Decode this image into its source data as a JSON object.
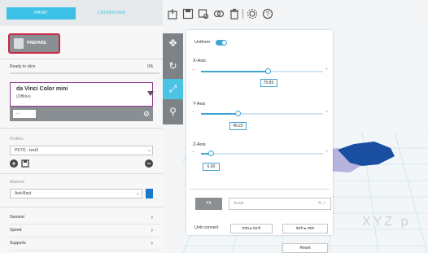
{
  "tabs": {
    "print": "PRINT",
    "catalog": "CATABRONIE"
  },
  "toolbar": {
    "icons": [
      "box-add-icon",
      "save-icon",
      "view-icon",
      "group-icon",
      "trash-icon",
      "settings-icon",
      "help-icon"
    ]
  },
  "prepare": {
    "label": "PREPARE"
  },
  "status": {
    "text": "Ready to slice",
    "percent": "0%",
    "progress": 0
  },
  "printer": {
    "name": "da Vinci Color mini",
    "status": "(Offline)",
    "field": "—"
  },
  "profiles": {
    "label": "Profiles",
    "selected": "PETG - test3"
  },
  "material": {
    "label": "Material",
    "selected": "Anti-Bact",
    "color": "#1a79c6"
  },
  "menu": {
    "items": [
      "General",
      "Speed",
      "Supports"
    ]
  },
  "transform": {
    "uniform_label": "Uniform",
    "uniform_on": true,
    "axes": [
      {
        "label": "X-Axis",
        "value": "75.85",
        "fraction": 0.55
      },
      {
        "label": "Y-Axis",
        "value": "49.22",
        "fraction": 0.3
      },
      {
        "label": "Z-Axis",
        "value": "6.00",
        "fraction": 0.08
      }
    ],
    "fit_label": "Fit",
    "scale_placeholder": "Scale",
    "scale_unit": "% ✓",
    "unit_convert_label": "Unit convert",
    "mm_to_inch": "mm ▸ inch",
    "inch_to_mm": "inch ▸ mm",
    "reset_label": "Reset"
  },
  "viewport": {
    "axis_text": "XYZ p",
    "model_colors": [
      "#b7b3df",
      "#1a4ea0"
    ]
  }
}
